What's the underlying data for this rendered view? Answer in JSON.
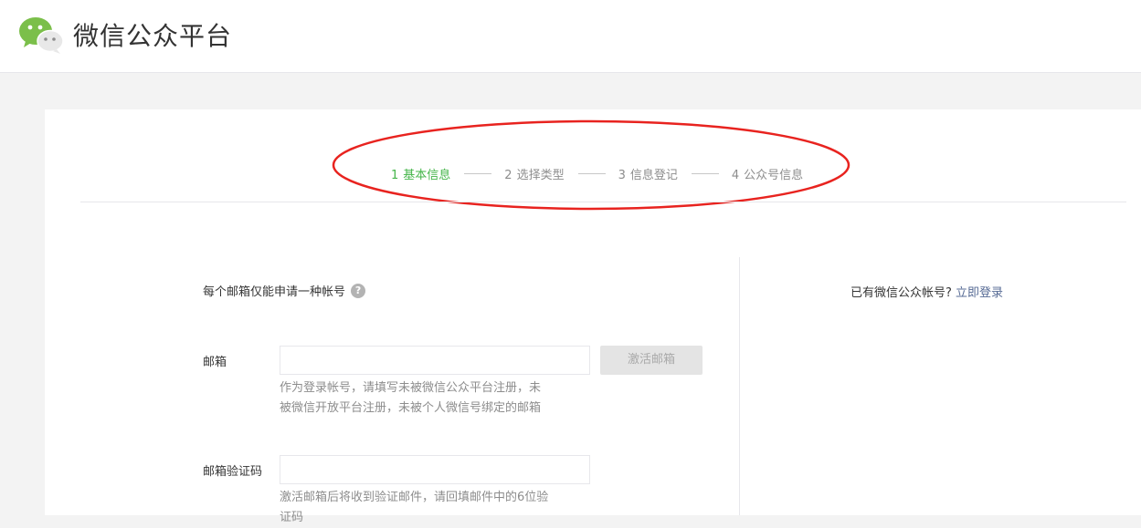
{
  "header": {
    "brand": "微信公众平台",
    "logo_icon": "wechat-logo-icon"
  },
  "steps": [
    {
      "num": "1",
      "label": "基本信息",
      "active": true
    },
    {
      "num": "2",
      "label": "选择类型",
      "active": false
    },
    {
      "num": "3",
      "label": "信息登记",
      "active": false
    },
    {
      "num": "4",
      "label": "公众号信息",
      "active": false
    }
  ],
  "form": {
    "notice": "每个邮箱仅能申请一种帐号",
    "help_icon": "?",
    "email_label": "邮箱",
    "email_value": "",
    "activate_button": "激活邮箱",
    "email_hint_line1": "作为登录帐号，请填写未被微信公众平台注册，未",
    "email_hint_line2": "被微信开放平台注册，未被个人微信号绑定的邮箱",
    "code_label": "邮箱验证码",
    "code_value": "",
    "code_hint_line1": "激活邮箱后将收到验证邮件，请回填邮件中的6位验",
    "code_hint_line2": "证码"
  },
  "side": {
    "login_prompt": "已有微信公众帐号?",
    "login_link": "立即登录"
  },
  "colors": {
    "accent_green": "#44b549",
    "link_blue": "#576b95",
    "annotation_red": "#e8231f"
  }
}
